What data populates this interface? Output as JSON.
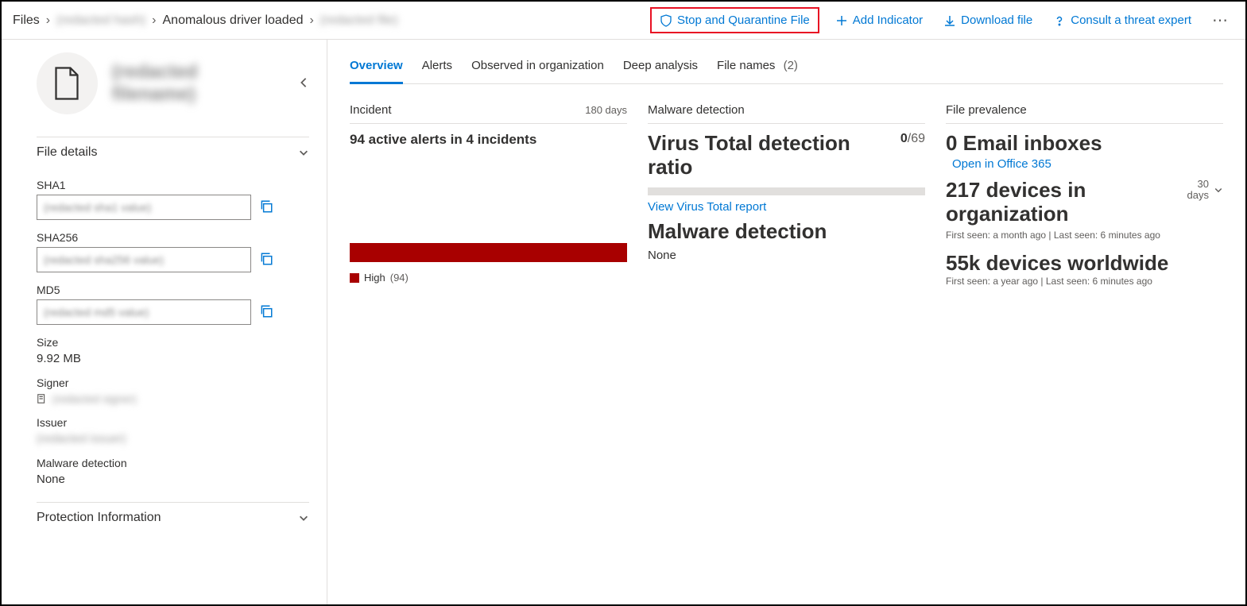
{
  "breadcrumb": {
    "root": "Files",
    "hash": "(redacted hash)",
    "alert": "Anomalous driver loaded",
    "file": "(redacted file)"
  },
  "actions": {
    "stop": "Stop and Quarantine File",
    "add_indicator": "Add Indicator",
    "download": "Download file",
    "consult": "Consult a threat expert"
  },
  "side": {
    "title": "(redacted filename)",
    "section_details": "File details",
    "sha1_label": "SHA1",
    "sha1_value": "(redacted sha1 value)",
    "sha256_label": "SHA256",
    "sha256_value": "(redacted sha256 value)",
    "md5_label": "MD5",
    "md5_value": "(redacted md5 value)",
    "size_label": "Size",
    "size_value": "9.92 MB",
    "signer_label": "Signer",
    "signer_value": "(redacted signer)",
    "issuer_label": "Issuer",
    "issuer_value": "(redacted issuer)",
    "malware_label": "Malware detection",
    "malware_value": "None",
    "section_protection": "Protection Information"
  },
  "tabs": {
    "overview": "Overview",
    "alerts": "Alerts",
    "observed": "Observed in organization",
    "deep": "Deep analysis",
    "filenames": "File names",
    "filenames_count": "(2)"
  },
  "incident": {
    "title": "Incident",
    "span": "180 days",
    "headline": "94 active alerts  in 4 incidents",
    "legend_label": "High",
    "legend_count": "(94)"
  },
  "malware": {
    "title": "Malware detection",
    "ratio_label": "Virus Total detection ratio",
    "ratio_num": "0",
    "ratio_den": "/69",
    "report_link": "View Virus Total report",
    "detection_label": "Malware detection",
    "detection_value": "None"
  },
  "prevalence": {
    "title": "File prevalence",
    "inboxes": "0 Email inboxes",
    "open_office": "Open in Office 365",
    "org_devices": "217 devices in organization",
    "org_meta": "First seen: a month ago | Last seen: 6 minutes ago",
    "world_devices": "55k devices worldwide",
    "world_meta": "First seen: a year ago | Last seen: 6 minutes ago",
    "days_num": "30",
    "days_label": "days"
  }
}
